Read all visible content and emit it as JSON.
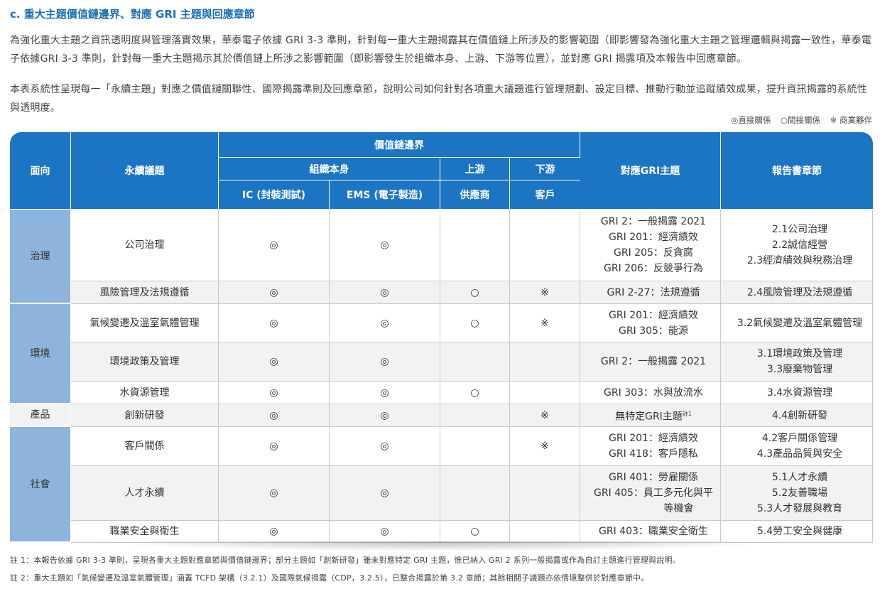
{
  "section_title": "c. 重大主題價值鏈邊界、對應 GRI 主題與回應章節",
  "paragraphs": [
    "為強化重大主題之資訊透明度與管理落實效果，華泰電子依據 GRI 3-3 準則，針對每一重大主題揭露其在價值鏈上所涉及的影響範圍（即影響發為強化重大主題之管理邏輯與揭露一致性，華泰電子依據GRI 3-3 準則，針對每一重大主題揭示其於價值鏈上所涉之影響範圍（即影響發生於組織本身、上游、下游等位置），並對應 GRI 揭露項及本報告中回應章節。",
    "本表系統性呈現每一「永續主題」對應之價值鏈關聯性、國際揭露準則及回應章節，說明公司如何針對各項重大議題進行管理規劃、設定目標、推動行動並追蹤績效成果，提升資訊揭露的系統性與透明度。"
  ],
  "legend": {
    "direct": "◎直接關係",
    "indirect": "○間接關係",
    "partner": "※ 商業夥伴"
  },
  "table": {
    "headers": {
      "aspect": "面向",
      "topic": "永續議題",
      "value_chain": "價值鏈邊界",
      "organization": "組織本身",
      "upstream": "上游",
      "downstream": "下游",
      "ic": "IC (封裝測試)",
      "ems": "EMS (電子製造)",
      "supplier": "供應商",
      "customer": "客戶",
      "gri": "對應GRI主題",
      "chapter": "報告書章節"
    },
    "aspects": {
      "governance": "治理",
      "environment": "環境",
      "product": "產品",
      "society": "社會"
    },
    "rows": [
      {
        "topic": "公司治理",
        "ic": "◎",
        "ems": "◎",
        "sup": "",
        "cust": "",
        "gri": [
          "GRI 2：一般揭露 2021",
          "GRI 201：經濟績效",
          "GRI 205：反貪腐",
          "GRI 206：反競爭行為"
        ],
        "chapter": [
          "2.1公司治理",
          "2.2誠信經營",
          "2.3經濟績效與稅務治理"
        ]
      },
      {
        "topic": "風險管理及法規遵循",
        "ic": "◎",
        "ems": "◎",
        "sup": "○",
        "cust": "※",
        "gri": [
          "GRI 2-27：法規遵循"
        ],
        "chapter": [
          "2.4風險管理及法規遵循"
        ]
      },
      {
        "topic": "氣候變遷及溫室氣體管理",
        "ic": "◎",
        "ems": "◎",
        "sup": "○",
        "cust": "※",
        "gri": [
          "GRI 201：經濟績效",
          "GRI 305：能源"
        ],
        "chapter": [
          "3.2氣候變遷及溫室氣體管理"
        ]
      },
      {
        "topic": "環境政策及管理",
        "ic": "◎",
        "ems": "◎",
        "sup": "",
        "cust": "",
        "gri": [
          "GRI 2：一般揭露 2021"
        ],
        "chapter": [
          "3.1環境政策及管理",
          "3.3廢棄物管理"
        ]
      },
      {
        "topic": "水資源管理",
        "ic": "◎",
        "ems": "◎",
        "sup": "○",
        "cust": "",
        "gri": [
          "GRI 303：水與放流水"
        ],
        "chapter": [
          "3.4水資源管理"
        ]
      },
      {
        "topic": "創新研發",
        "ic": "◎",
        "ems": "◎",
        "sup": "",
        "cust": "※",
        "gri": [
          "無特定GRI主題"
        ],
        "gri_sup": "註1",
        "chapter": [
          "4.4創新研發"
        ]
      },
      {
        "topic": "客戶關係",
        "ic": "◎",
        "ems": "◎",
        "sup": "",
        "cust": "※",
        "gri": [
          "GRI 201：經濟績效",
          "GRI 418：客戶隱私"
        ],
        "chapter": [
          "4.2客戶關係管理",
          "4.3產品品質與安全"
        ]
      },
      {
        "topic": "人才永續",
        "ic": "◎",
        "ems": "◎",
        "sup": "",
        "cust": "",
        "gri": [
          "GRI 401：勞雇關係",
          "GRI 405：員工多元化與平",
          "等機會"
        ],
        "chapter": [
          "5.1人才永續",
          "5.2友善職場",
          "5.3人才發展與教育"
        ]
      },
      {
        "topic": "職業安全與衛生",
        "ic": "◎",
        "ems": "◎",
        "sup": "○",
        "cust": "",
        "gri": [
          "GRI 403：職業安全衛生"
        ],
        "chapter": [
          "5.4勞工安全與健康"
        ]
      }
    ]
  },
  "notes": [
    "註 1：本報告依據 GRI 3-3 準則，呈現各重大主題對應章節與價值鏈邊界；部分主題如「創新研發」雖未對應特定 GRI 主題，惟已納入 GRI 2 系列一般揭露或作為自訂主題進行管理與說明。",
    "註 2：重大主題如「氣候變遷及溫室氣體管理」涵蓋 TCFD 架構（3.2.1）及國際氣候揭露（CDP，3.2.5），已整合揭露於第 3.2 章節；其餘相關子議題亦依情境整併於對應章節中。"
  ]
}
